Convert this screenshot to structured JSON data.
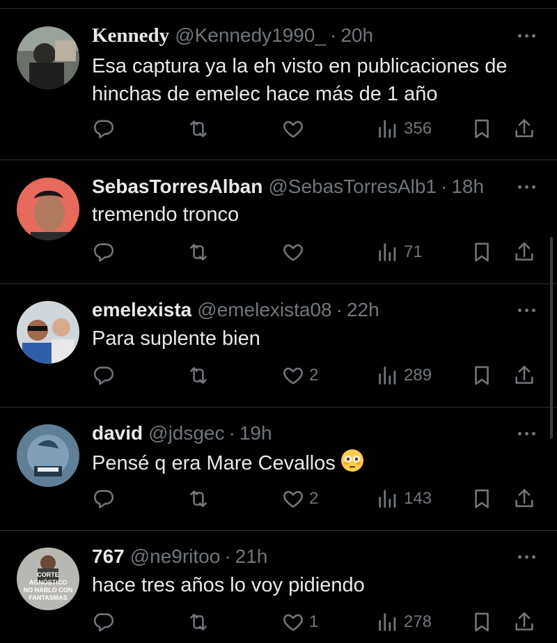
{
  "colors": {
    "background": "#000000",
    "text_primary": "#e7e9ea",
    "text_secondary": "#71767b",
    "divider": "#2f3336"
  },
  "icons": {
    "reply": "reply-icon",
    "retweet": "retweet-icon",
    "like": "heart-icon",
    "views": "views-chart-icon",
    "bookmark": "bookmark-icon",
    "share": "share-icon",
    "more": "more-dots-icon"
  },
  "tweets": [
    {
      "name": "Kennedy",
      "handle": "@Kennedy1990_",
      "separator": "·",
      "time": "20h",
      "text_lines": [
        "Esa captura ya la eh visto en publicaciones de",
        "hinchas de emelec hace más de 1 año"
      ],
      "likes": "",
      "views": "356"
    },
    {
      "name": "SebasTorresAlban",
      "handle": "@SebasTorresAlb1",
      "separator": "·",
      "time": "18h",
      "text_lines": [
        "tremendo tronco"
      ],
      "likes": "",
      "views": "71"
    },
    {
      "name": "emelexista",
      "handle": "@emelexista08",
      "separator": "·",
      "time": "22h",
      "text_lines": [
        "Para suplente bien"
      ],
      "likes": "2",
      "views": "289"
    },
    {
      "name": "david",
      "handle": "@jdsgec",
      "separator": "·",
      "time": "19h",
      "text_lines": [
        "Pensé q era Mare Cevallos"
      ],
      "emoji": "flushed-face",
      "likes": "2",
      "views": "143"
    },
    {
      "name": "767",
      "handle": "@ne9ritoo",
      "separator": "·",
      "time": "21h",
      "text_lines": [
        "hace tres años lo voy pidiendo"
      ],
      "avatar_text": [
        "CORTE",
        "AGNÓSTICO",
        "NO HABLO CON",
        "FANTASMAS"
      ],
      "likes": "1",
      "views": "278"
    }
  ]
}
